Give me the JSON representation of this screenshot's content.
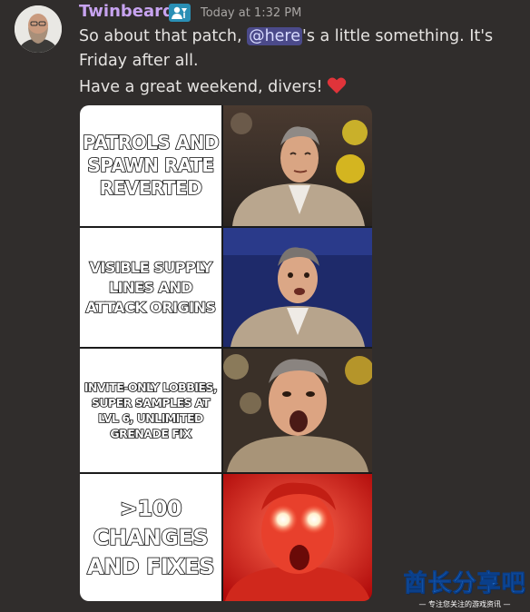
{
  "message": {
    "username": "Twinbeard",
    "timestamp": "Today at 1:32 PM",
    "line1_before": "So about that patch, ",
    "mention": "@here",
    "line1_after": "'s a little something. It's",
    "line2": "Friday after all.",
    "line3": "Have a great weekend, divers!",
    "role_icon": "role-badge-icon",
    "emoji": "red-heart"
  },
  "meme": {
    "panels": [
      {
        "text": "PATROLS AND SPAWN RATE REVERTED"
      },
      {
        "text": "VISIBLE SUPPLY LINES AND ATTACK ORIGINS"
      },
      {
        "text": "INVITE-ONLY LOBBIES, SUPER SAMPLES AT LVL 6, UNLIMITED GRENADE FIX"
      },
      {
        "text": ">100 CHANGES AND FIXES"
      }
    ]
  },
  "watermark": {
    "main": "酋长分享吧",
    "sub": "— 专注您关注的游戏资讯 —"
  },
  "colors": {
    "background": "#302d2c",
    "username": "#c7a3f0",
    "mention_bg": "#4b4a8a",
    "heart": "#e0343a"
  }
}
